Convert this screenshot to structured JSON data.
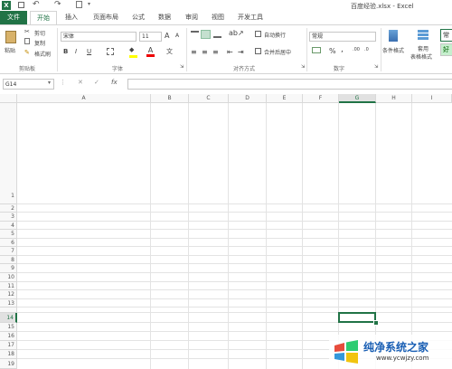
{
  "title": {
    "filename": "百度经验.xlsx - Excel"
  },
  "tabs": [
    {
      "label": "文件"
    },
    {
      "label": "开始"
    },
    {
      "label": "插入"
    },
    {
      "label": "页面布局"
    },
    {
      "label": "公式"
    },
    {
      "label": "数据"
    },
    {
      "label": "审阅"
    },
    {
      "label": "视图"
    },
    {
      "label": "开发工具"
    }
  ],
  "ribbon": {
    "clipboard": {
      "paste": "粘贴",
      "cut": "剪切",
      "copy": "复制",
      "format_painter": "格式刷",
      "label": "剪贴板"
    },
    "font": {
      "name": "宋体",
      "size": "11",
      "label": "字体",
      "bold": "B",
      "italic": "I",
      "underline": "U",
      "grow": "A",
      "shrink": "A"
    },
    "alignment": {
      "wrap": "自动换行",
      "merge": "合并后居中",
      "label": "对齐方式"
    },
    "number": {
      "format": "常规",
      "percent": "%",
      "comma": ",",
      "label": "数字"
    },
    "styles": {
      "conditional": "条件格式",
      "table": "套用",
      "table2": "表格格式",
      "cell_style_good": "好",
      "cell_style_normal": "常"
    }
  },
  "formula_bar": {
    "name_box": "G14",
    "fx": "fx",
    "value": ""
  },
  "columns": [
    "A",
    "B",
    "C",
    "D",
    "E",
    "F",
    "G",
    "H",
    "I"
  ],
  "rows": [
    "1",
    "2",
    "3",
    "4",
    "5",
    "6",
    "7",
    "8",
    "9",
    "10",
    "11",
    "12",
    "13",
    "14",
    "15",
    "16",
    "17",
    "18",
    "19"
  ],
  "selected_cell": "G14",
  "watermark": {
    "brand": "纯净系统之家",
    "url": "www.ycwjzy.com"
  },
  "colors": {
    "accent": "#217346",
    "watermark_blue": "#1a5fb4"
  }
}
